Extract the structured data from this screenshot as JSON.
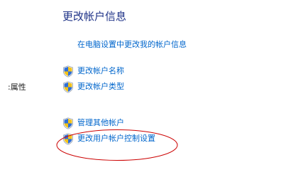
{
  "heading": "更改帐户信息",
  "settings_link": "在电脑设置中更改我的帐户信息",
  "side_label": ":属性",
  "tasks": [
    {
      "label": "更改帐户名称",
      "icon": "uac-shield-icon"
    },
    {
      "label": "更改帐户类型",
      "icon": "uac-shield-icon"
    },
    {
      "label": "管理其他帐户",
      "icon": "uac-shield-icon"
    },
    {
      "label": "更改用户帐户控制设置",
      "icon": "uac-shield-icon"
    }
  ],
  "colors": {
    "heading": "#1e3287",
    "link": "#0066cc",
    "annotation": "#cc0000",
    "shield_blue": "#2f6fd6",
    "shield_yellow": "#f2c21b"
  }
}
